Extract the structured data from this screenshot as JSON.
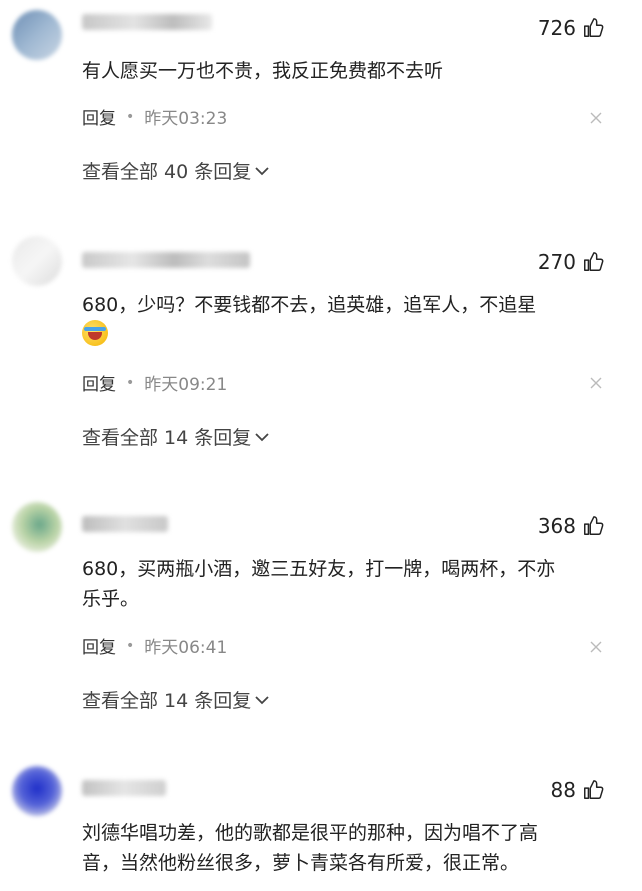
{
  "comments": [
    {
      "likes": "726",
      "text": "有人愿买一万也不贵，我反正免费都不去听",
      "reply_label": "回复",
      "time": "昨天03:23",
      "more_replies": "查看全部 40 条回复"
    },
    {
      "likes": "270",
      "text": "680，少吗？不要钱都不去，追英雄，追军人，不追星",
      "reply_label": "回复",
      "time": "昨天09:21",
      "more_replies": "查看全部 14 条回复"
    },
    {
      "likes": "368",
      "text_line1": "680，买两瓶小酒，邀三五好友，打一牌，喝两杯，不亦",
      "text_line2": "乐乎。",
      "reply_label": "回复",
      "time": "昨天06:41",
      "more_replies": "查看全部 14 条回复"
    },
    {
      "likes": "88",
      "text_line1": "刘德华唱功差，他的歌都是很平的那种，因为唱不了高",
      "text_line2": "音，当然他粉丝很多，萝卜青菜各有所爱，很正常。"
    }
  ],
  "icons": {
    "like": "thumbs-up-icon",
    "close": "close-icon",
    "expand": "chevron-down-icon",
    "emoji": "laughing-crying-emoji-icon"
  }
}
